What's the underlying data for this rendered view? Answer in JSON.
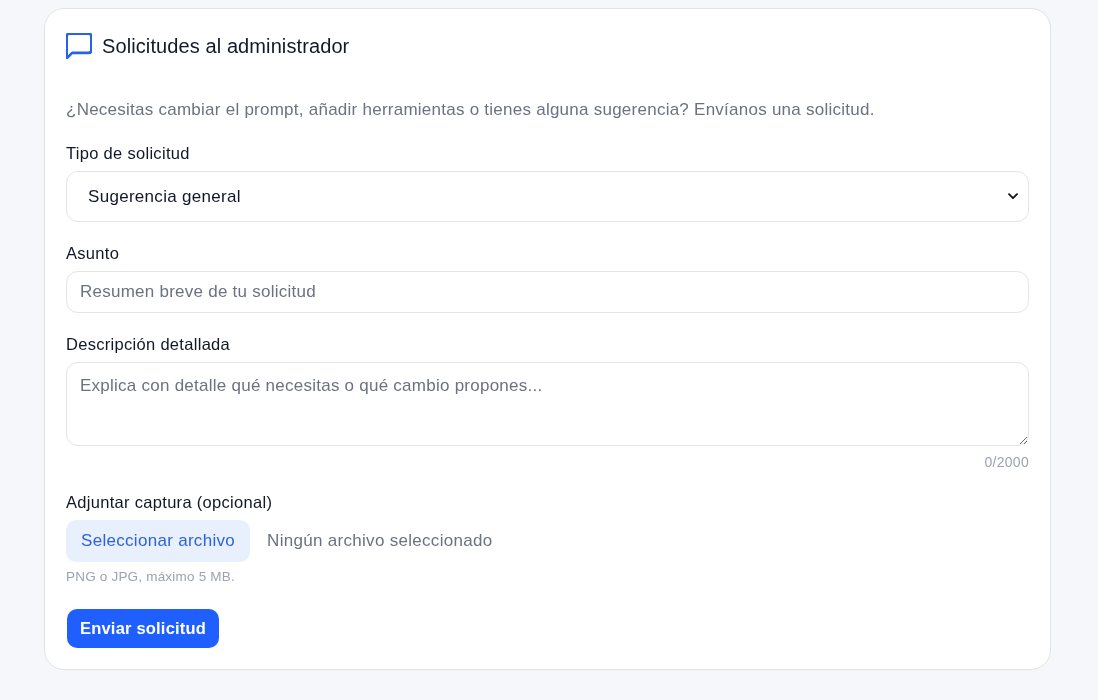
{
  "card": {
    "title": "Solicitudes al administrador",
    "description": "¿Necesitas cambiar el prompt, añadir herramientas o tienes alguna sugerencia? Envíanos una solicitud."
  },
  "fields": [
    {
      "kind": "select",
      "label": "Tipo de solicitud",
      "value": "Sugerencia general"
    },
    {
      "kind": "input",
      "label": "Asunto",
      "placeholder": "Resumen breve de tu solicitud"
    },
    {
      "kind": "textarea",
      "label": "Descripción detallada",
      "placeholder": "Explica con detalle qué necesitas o qué cambio propones...",
      "counter": "0/2000"
    },
    {
      "kind": "file",
      "label": "Adjuntar captura (opcional)",
      "button": "Seleccionar archivo",
      "status": "Ningún archivo seleccionado",
      "hint": "PNG o JPG, máximo 5 MB."
    }
  ],
  "submit": "Enviar solicitud"
}
